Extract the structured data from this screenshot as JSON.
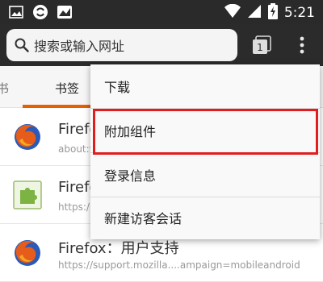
{
  "status_bar": {
    "time": "5:21",
    "icons_left": [
      "image-icon",
      "sync-icon",
      "photo-icon"
    ],
    "icons_right": [
      "wifi-icon",
      "cellular-icon",
      "battery-charging-icon"
    ]
  },
  "toolbar": {
    "search_placeholder": "搜索或输入网址",
    "tab_count": "1"
  },
  "tabs": [
    {
      "label": "书"
    },
    {
      "label": "书签"
    }
  ],
  "list_items": [
    {
      "title": "Firefo",
      "url": "about:f",
      "icon": "firefox-logo-icon"
    },
    {
      "title": "Firefo",
      "url": "https:/",
      "icon": "addon-puzzle-icon"
    },
    {
      "title": "Firefox：用户支持",
      "url": "https://support.mozilla....ampaign=mobileandroid",
      "icon": "firefox-logo-icon"
    }
  ],
  "menu": {
    "items": [
      {
        "label": "下载"
      },
      {
        "label": "附加组件"
      },
      {
        "label": "登录信息"
      },
      {
        "label": "新建访客会话"
      }
    ],
    "highlighted_index": 1
  },
  "colors": {
    "accent_orange": "#e66000",
    "highlight_red": "#e11d1d",
    "toolbar_bg": "#2b2b2b"
  }
}
